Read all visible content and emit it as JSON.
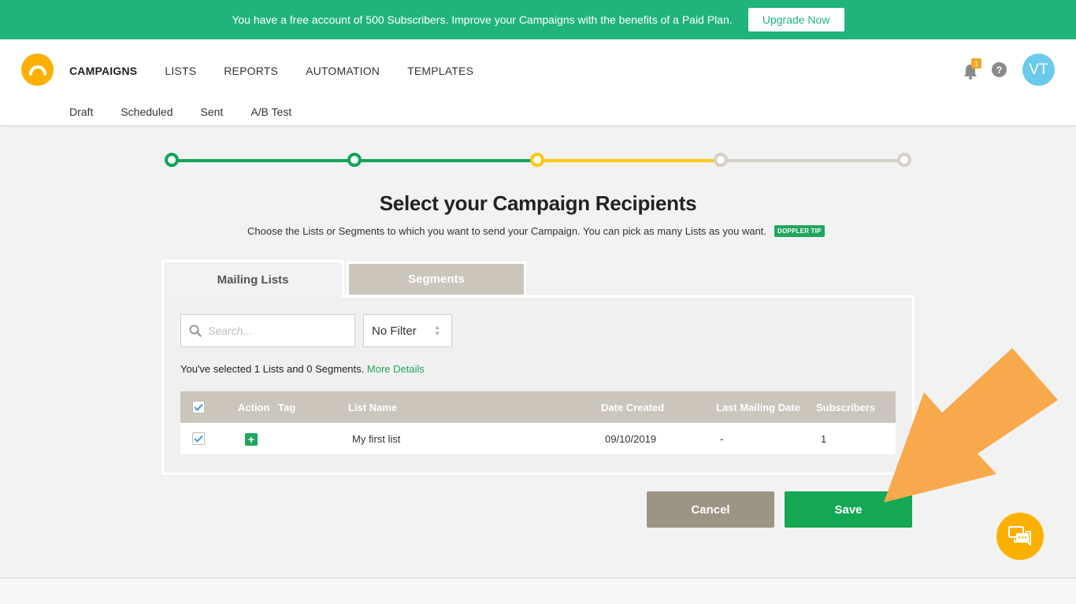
{
  "promo": {
    "text": "You have a free account of 500 Subscribers. Improve your Campaigns with the benefits of a Paid Plan.",
    "button": "Upgrade Now"
  },
  "nav": {
    "items": [
      "CAMPAIGNS",
      "LISTS",
      "REPORTS",
      "AUTOMATION",
      "TEMPLATES"
    ],
    "active": "CAMPAIGNS"
  },
  "subnav": {
    "items": [
      "Draft",
      "Scheduled",
      "Sent",
      "A/B Test"
    ]
  },
  "header": {
    "notification_count": "1",
    "help_label": "?",
    "avatar_initials": "VT"
  },
  "stepper": {
    "total_steps": 5,
    "completed_steps": 2,
    "current_step": 3,
    "colors": {
      "done": "#13a35b",
      "current": "#f8c814",
      "pending": "#d4cfc5"
    }
  },
  "page": {
    "title": "Select your Campaign Recipients",
    "subtitle": "Choose the Lists or Segments to which you want to send your Campaign. You can pick as many Lists as you want.",
    "tip_badge": "DOPPLER TIP"
  },
  "tabs": {
    "mailing_lists": "Mailing Lists",
    "segments": "Segments"
  },
  "controls": {
    "search_placeholder": "Search...",
    "filter_value": "No Filter"
  },
  "selection": {
    "summary": "You've selected 1 Lists and 0 Segments.",
    "link": "More Details"
  },
  "table": {
    "headers": {
      "action": "Action",
      "tag": "Tag",
      "list_name": "List Name",
      "date_created": "Date Created",
      "last_mailing": "Last Mailing Date",
      "subscribers": "Subscribers"
    },
    "rows": [
      {
        "list_name": "My first list",
        "date_created": "09/10/2019",
        "last_mailing": "-",
        "subscribers": "1",
        "checked": true
      }
    ]
  },
  "buttons": {
    "cancel": "Cancel",
    "save": "Save"
  },
  "colors": {
    "brand_green": "#20b47b",
    "save_green": "#14a754",
    "accent_orange": "#f7a94b",
    "logo_yellow": "#fbb000"
  }
}
